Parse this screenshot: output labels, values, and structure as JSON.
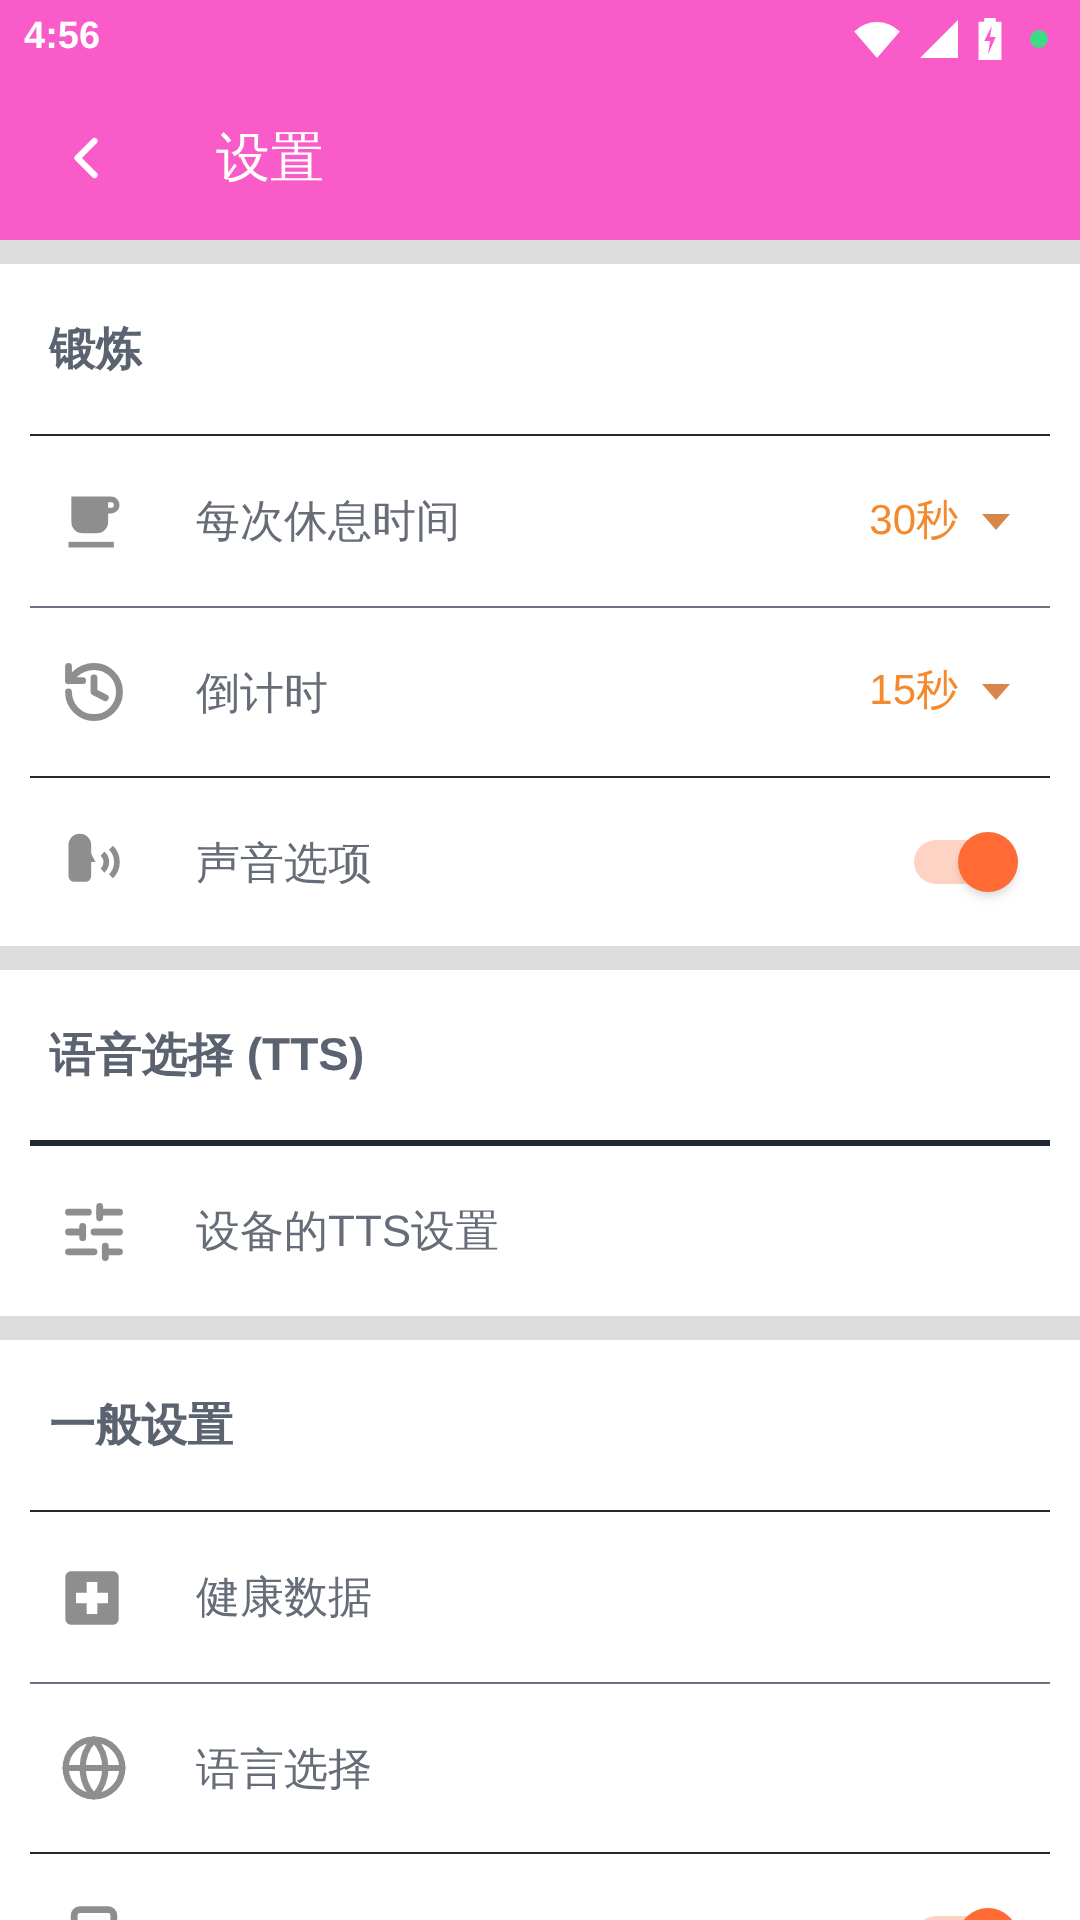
{
  "status_bar": {
    "time": "4:56"
  },
  "toolbar": {
    "title": "设置"
  },
  "sections": [
    {
      "title": "锻炼",
      "items": [
        {
          "kind": "dropdown",
          "label": "每次休息时间",
          "value": "30秒"
        },
        {
          "kind": "dropdown",
          "label": "倒计时",
          "value": "15秒"
        },
        {
          "kind": "toggle",
          "label": "声音选项",
          "on": true
        }
      ]
    },
    {
      "title": "语音选择 (TTS)",
      "items": [
        {
          "kind": "link",
          "label": "设备的TTS设置"
        }
      ]
    },
    {
      "title": "一般设置",
      "items": [
        {
          "kind": "link",
          "label": "健康数据"
        },
        {
          "kind": "link",
          "label": "语言选择"
        },
        {
          "kind": "toggle",
          "on": true
        }
      ]
    }
  ]
}
